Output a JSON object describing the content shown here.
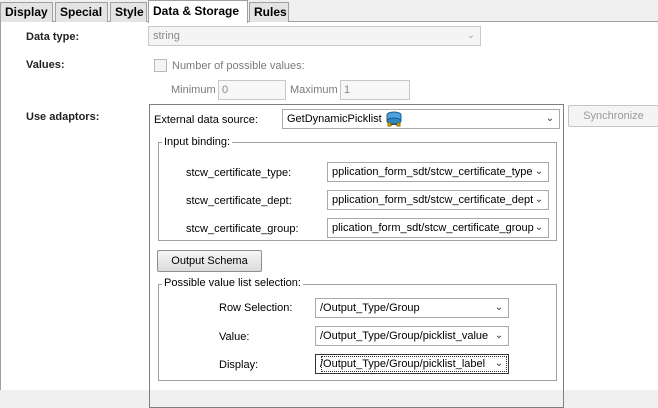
{
  "tabs": [
    {
      "label": "Display",
      "active": false
    },
    {
      "label": "Special",
      "active": false
    },
    {
      "label": "Style",
      "active": false
    },
    {
      "label": "Data & Storage",
      "active": true
    },
    {
      "label": "Rules",
      "active": false
    }
  ],
  "data_type": {
    "label": "Data type:",
    "value": "string"
  },
  "values": {
    "label": "Values:",
    "checkbox_label": "Number of possible values:",
    "minimum_label": "Minimum",
    "minimum_value": "0",
    "maximum_label": "Maximum",
    "maximum_value": "1"
  },
  "use_adaptors": {
    "label": "Use adaptors:"
  },
  "external_source": {
    "label": "External data source:",
    "value": "GetDynamicPicklist",
    "icon": "database-network-icon"
  },
  "synchronize_label": "Synchronize",
  "input_binding": {
    "legend": "Input binding:",
    "rows": [
      {
        "label": "stcw_certificate_type:",
        "value": "pplication_form_sdt/stcw_certificate_type"
      },
      {
        "label": "stcw_certificate_dept:",
        "value": "pplication_form_sdt/stcw_certificate_dept"
      },
      {
        "label": "stcw_certificate_group:",
        "value": "plication_form_sdt/stcw_certificate_group"
      }
    ]
  },
  "output_schema_label": "Output Schema",
  "possible_values": {
    "legend": "Possible value list selection:",
    "rows": [
      {
        "label": "Row Selection:",
        "value": "/Output_Type/Group"
      },
      {
        "label": "Value:",
        "value": "/Output_Type/Group/picklist_value"
      },
      {
        "label": "Display:",
        "value": "/Output_Type/Group/picklist_label"
      }
    ]
  },
  "colors": {
    "tab_active": "#ffffff",
    "tab_inactive": "#e4e4e4",
    "disabled_text": "#8a8a8a"
  }
}
